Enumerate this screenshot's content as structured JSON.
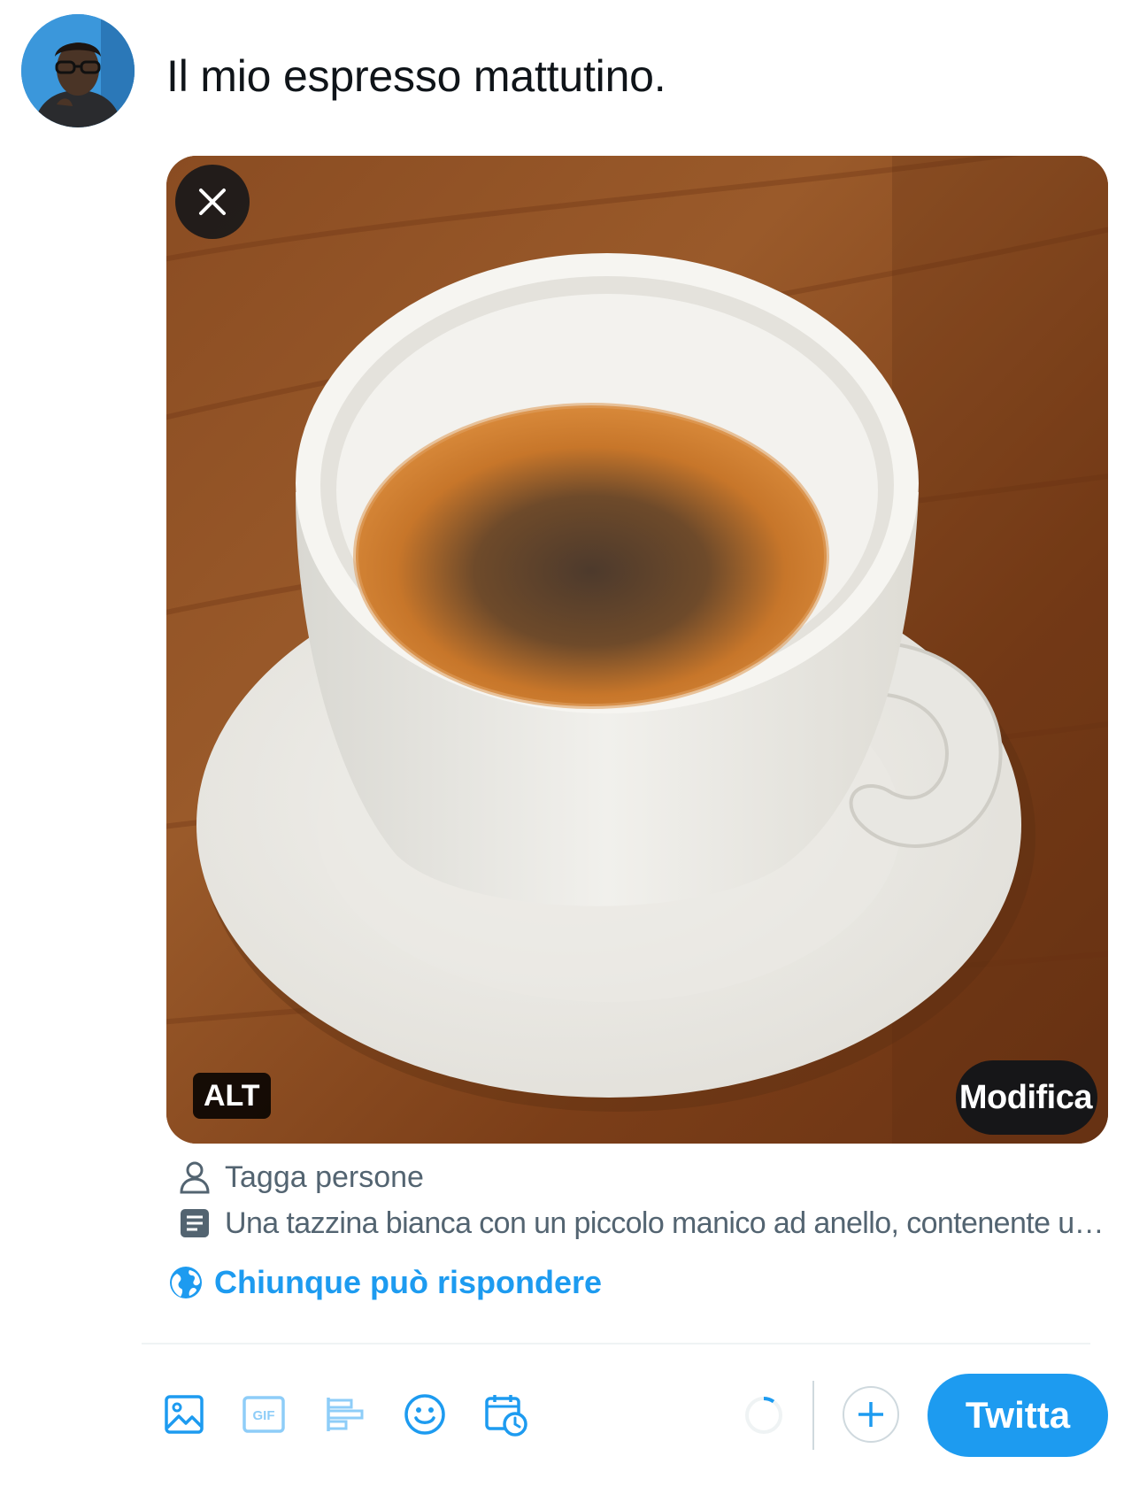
{
  "composer": {
    "text": "Il mio espresso mattutino.",
    "avatar_icon": "user-avatar"
  },
  "media": {
    "alt_label": "ALT",
    "edit_label": "Modifica",
    "remove_icon": "close-icon"
  },
  "media_meta": {
    "tag_label": "Tagga persone",
    "alt_text_preview": "Una tazzina bianca con un piccolo manico ad anello, contenente un..."
  },
  "reply_setting": {
    "label": "Chiunque può rispondere",
    "icon": "globe-icon"
  },
  "toolbar": {
    "icons": [
      "image-icon",
      "gif-icon",
      "poll-icon",
      "emoji-icon",
      "schedule-icon"
    ],
    "gif_label": "GIF",
    "tweet_label": "Twitta"
  },
  "colors": {
    "accent": "#1d9bf0",
    "secondary_text": "#536471",
    "border": "#cfd9de"
  }
}
